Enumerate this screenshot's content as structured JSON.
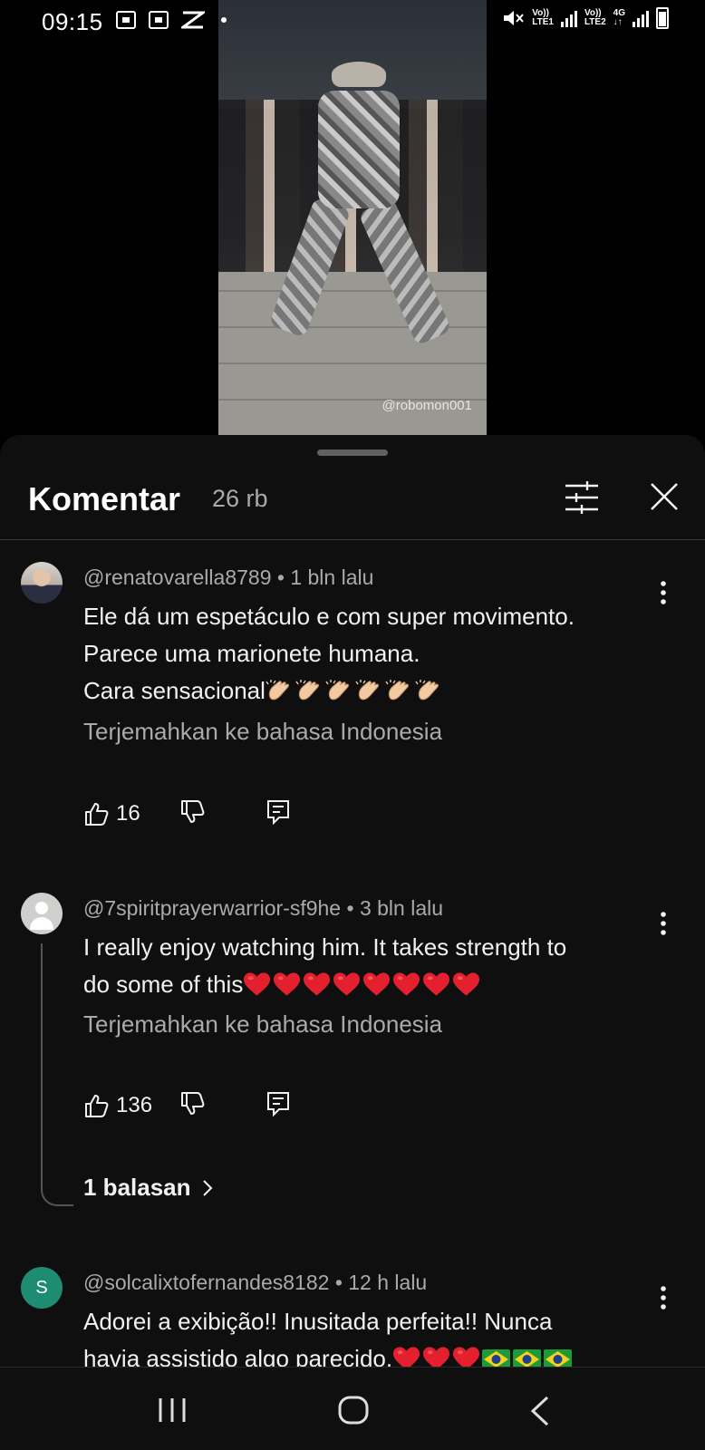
{
  "status_bar": {
    "time": "09:15",
    "sim1_label_top": "Vo))",
    "sim1_label_bottom": "LTE1",
    "sim2_label_top": "Vo))",
    "sim2_label_bottom": "LTE2",
    "network": "4G"
  },
  "video": {
    "watermark": "@robomon001"
  },
  "comments_sheet": {
    "title": "Komentar",
    "count": "26 rb",
    "comments": [
      {
        "author": "@renatovarella8789",
        "time": "1 bln lalu",
        "line1": "Ele dá um espetáculo e com super movimento.",
        "line2": "Parece uma marionete humana.",
        "line3": "Cara sensacional",
        "translate": "Terjemahkan ke bahasa Indonesia",
        "likes": "16"
      },
      {
        "author": "@7spiritprayerwarrior-sf9he",
        "time": "3 bln lalu",
        "line1": "I really enjoy watching him. It takes strength to",
        "line2": "do some of this",
        "translate": "Terjemahkan ke bahasa Indonesia",
        "likes": "136",
        "replies": "1 balasan"
      },
      {
        "author": "@solcalixtofernandes8182",
        "time": "12 h lalu",
        "avatar_letter": "S",
        "line1": "Adorei a exibição!! Inusitada perfeita!! Nunca",
        "line2": "havia assistido algo parecido."
      }
    ]
  },
  "icons": {
    "like": "thumb-up-icon",
    "dislike": "thumb-down-icon",
    "reply": "reply-icon",
    "more": "more-vert-icon",
    "filter": "sort-filter-icon",
    "close": "close-icon"
  },
  "colors": {
    "sheet_bg": "#0f0f0f",
    "secondary_text": "#aaaaaa",
    "avatar_s": "#1e8c73"
  }
}
